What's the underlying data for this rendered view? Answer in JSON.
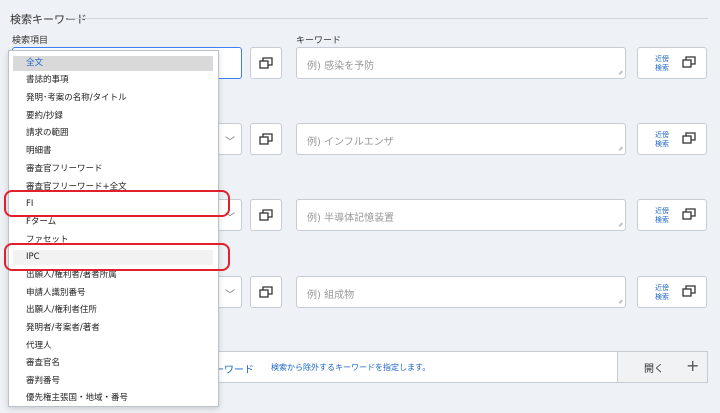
{
  "section": {
    "title": "検索キーワード"
  },
  "labels": {
    "search_field": "検索項目",
    "keyword": "キーワード"
  },
  "rows": [
    {
      "placeholder": "例) 感染を予防"
    },
    {
      "placeholder": "例) インフルエンザ"
    },
    {
      "placeholder": "例) 半導体記憶装置"
    },
    {
      "placeholder": "例) 組成物"
    }
  ],
  "near_button": {
    "line1": "近傍",
    "line2": "検索"
  },
  "exclude": {
    "title": "ーワード",
    "description": "検索から除外するキーワードを指定します。",
    "open_label": "開く",
    "plus": "+"
  },
  "dropdown": {
    "items": [
      "全文",
      "書誌的事項",
      "発明･考案の名称/タイトル",
      "要約/抄録",
      "請求の範囲",
      "明細書",
      "審査官フリーワード",
      "審査官フリーワード+全文",
      "FI",
      "Fターム",
      "ファセット",
      "IPC",
      "出願人/権利者/著者所属",
      "申請人識別番号",
      "出願人/権利者住所",
      "発明者/考案者/著者",
      "代理人",
      "審査官名",
      "審判番号",
      "優先権主張国・地域・番号"
    ]
  },
  "colors": {
    "accent": "#1a66c8",
    "callout": "#e0202a",
    "selected_bg": "#d9d9d9"
  }
}
